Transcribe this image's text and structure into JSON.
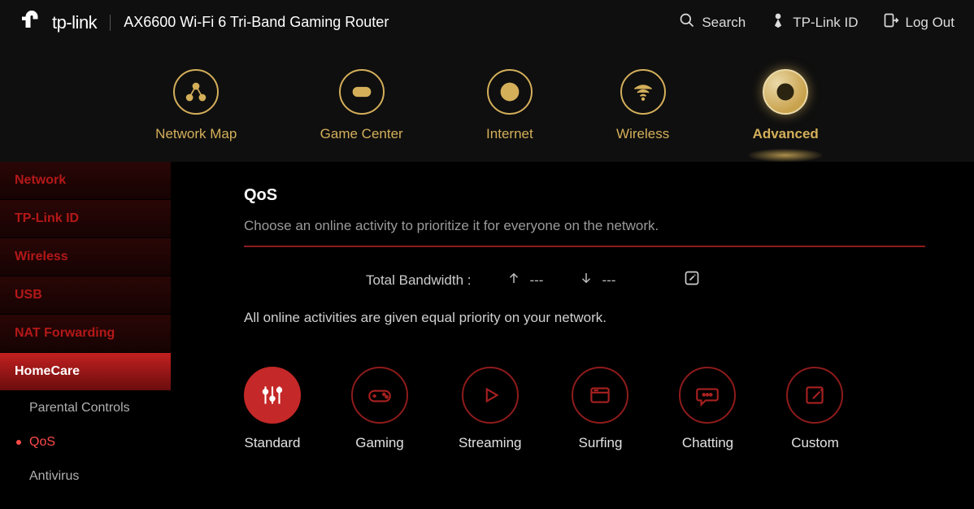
{
  "header": {
    "brand": "tp-link",
    "product": "AX6600 Wi-Fi 6 Tri-Band Gaming Router",
    "search_label": "Search",
    "tplink_id_label": "TP-Link ID",
    "logout_label": "Log Out"
  },
  "mainnav": {
    "items": [
      {
        "label": "Network Map",
        "icon": "network-map-icon",
        "active": false
      },
      {
        "label": "Game Center",
        "icon": "gamepad-icon",
        "active": false
      },
      {
        "label": "Internet",
        "icon": "globe-icon",
        "active": false
      },
      {
        "label": "Wireless",
        "icon": "wifi-icon",
        "active": false
      },
      {
        "label": "Advanced",
        "icon": "gear-core-icon",
        "active": true
      }
    ]
  },
  "sidebar": {
    "items": [
      {
        "label": "Network"
      },
      {
        "label": "TP-Link ID"
      },
      {
        "label": "Wireless"
      },
      {
        "label": "USB"
      },
      {
        "label": "NAT Forwarding"
      },
      {
        "label": "HomeCare",
        "active": true,
        "children": [
          {
            "label": "Parental Controls",
            "selected": false
          },
          {
            "label": "QoS",
            "selected": true
          },
          {
            "label": "Antivirus",
            "selected": false
          }
        ]
      }
    ]
  },
  "panel": {
    "title": "QoS",
    "description": "Choose an online activity to prioritize it for everyone on the network.",
    "bandwidth": {
      "label": "Total Bandwidth :",
      "up": "---",
      "down": "---"
    },
    "status": "All online activities are given equal priority on your network.",
    "modes": [
      {
        "label": "Standard",
        "icon": "sliders-icon",
        "selected": true
      },
      {
        "label": "Gaming",
        "icon": "gamepad2-icon",
        "selected": false
      },
      {
        "label": "Streaming",
        "icon": "play-icon",
        "selected": false
      },
      {
        "label": "Surfing",
        "icon": "browser-icon",
        "selected": false
      },
      {
        "label": "Chatting",
        "icon": "chat-icon",
        "selected": false
      },
      {
        "label": "Custom",
        "icon": "edit-square-icon",
        "selected": false
      }
    ]
  }
}
